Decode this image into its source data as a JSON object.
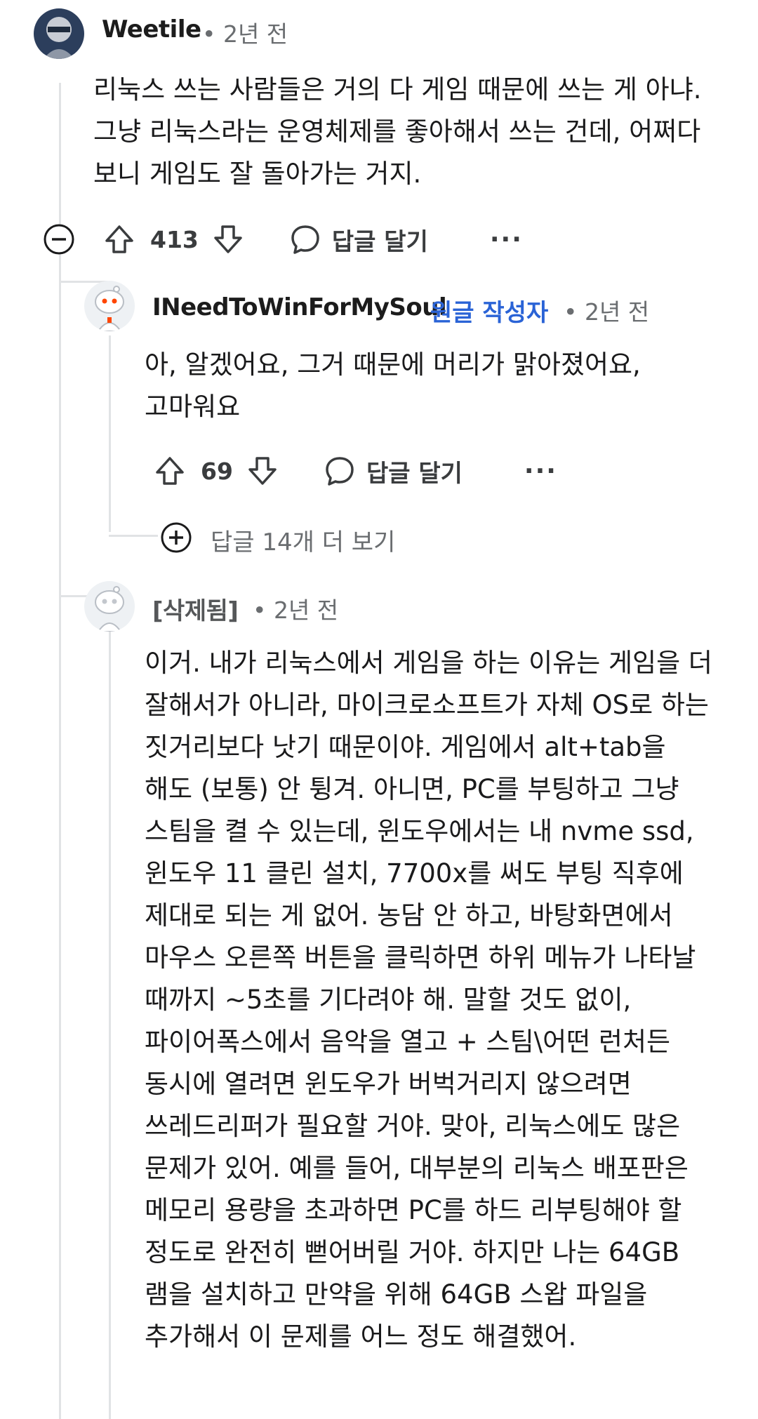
{
  "comments": [
    {
      "author": "Weetile",
      "time": "• 2년 전",
      "body": "리눅스 쓰는 사람들은 거의 다 게임 때문에 쓰는 게 아냐. 그냥 리눅스라는 운영체제를 좋아해서 쓰는 건데, 어쩌다 보니 게임도 잘 돌아가는 거지.",
      "score": "413",
      "reply_label": "답글 달기",
      "more_label": "···"
    },
    {
      "author": "INeedToWinForMySoul",
      "op_badge": "원글 작성자",
      "time": "• 2년 전",
      "body": "아, 알겠어요, 그거 때문에 머리가 맑아졌어요, 고마워요",
      "score": "69",
      "reply_label": "답글 달기",
      "more_label": "···"
    },
    {
      "author": "[삭제됨]",
      "time": "• 2년 전",
      "body": "이거. 내가 리눅스에서 게임을 하는 이유는 게임을 더 잘해서가 아니라, 마이크로소프트가 자체 OS로 하는 짓거리보다 낫기 때문이야. 게임에서 alt+tab을 해도 (보통) 안 튕겨. 아니면, PC를 부팅하고 그냥 스팀을 켤 수 있는데, 윈도우에서는 내 nvme ssd, 윈도우 11 클린 설치, 7700x를 써도 부팅 직후에 제대로 되는 게 없어. 농담 안 하고, 바탕화면에서 마우스 오른쪽 버튼을 클릭하면 하위 메뉴가 나타날 때까지 ~5초를 기다려야 해. 말할 것도 없이, 파이어폭스에서 음악을 열고 + 스팀\\어떤 런처든 동시에 열려면 윈도우가 버벅거리지 않으려면 쓰레드리퍼가 필요할 거야. 맞아, 리눅스에도 많은 문제가 있어. 예를 들어, 대부분의 리눅스 배포판은 메모리 용량을 초과하면 PC를 하드 리부팅해야 할 정도로 완전히 뻗어버릴 거야. 하지만 나는 64GB 램을 설치하고 만약을 위해 64GB 스왑 파일을 추가해서 이 문제를 어느 정도 해결했어."
    }
  ],
  "more_replies_label": "답글 14개 더 보기",
  "colors": {
    "op_badge": "#2a63d6",
    "thread_line": "#e1e3e5",
    "meta": "#6a6d70"
  }
}
